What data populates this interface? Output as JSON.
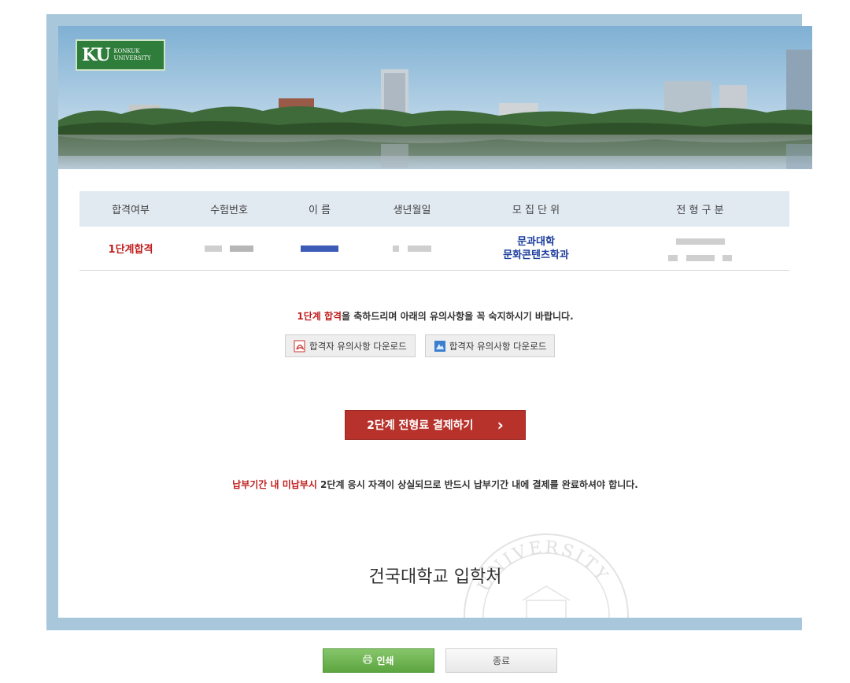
{
  "logo": {
    "mark": "KU",
    "name_line1": "KONKUK",
    "name_line2": "UNIVERSITY"
  },
  "table": {
    "headers": [
      "합격여부",
      "수험번호",
      "이 름",
      "생년월일",
      "모 집 단 위",
      "전 형 구 분"
    ],
    "row": {
      "status": "1단계합격",
      "unit_line1": "문과대학",
      "unit_line2": "문화콘텐츠학과"
    }
  },
  "notice1": {
    "highlight": "1단계 합격",
    "rest": "을 축하드리며 아래의 유의사항을 꼭 숙지하시기 바랍니다."
  },
  "downloads": [
    {
      "label": "합격자 유의사항 다운로드",
      "icon": "pdf-icon"
    },
    {
      "label": "합격자 유의사항 다운로드",
      "icon": "document-icon"
    }
  ],
  "pay_button": {
    "label": "2단계 전형료 결제하기",
    "arrow": "›"
  },
  "notice2": {
    "highlight": "납부기간 내 미납부시",
    "rest": " 2단계 응시 자격이 상실되므로 반드시 납부기간 내에 결제를 완료하셔야 합니다."
  },
  "footer": {
    "title": "건국대학교 입학처",
    "seal_text": "UNIVERSITY"
  },
  "buttons": {
    "print_label": "인쇄",
    "close_label": "종료"
  },
  "colors": {
    "frame": "#a9c7da",
    "accent_red": "#c11d1d",
    "unit_blue": "#1a3c9c",
    "pay_button": "#b8322c",
    "print_button": "#6ab04c"
  }
}
